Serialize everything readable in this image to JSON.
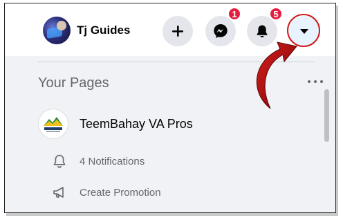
{
  "header": {
    "profile_name": "Tj Guides",
    "messenger_badge": "1",
    "notifications_badge": "5"
  },
  "icons": {
    "create": "plus-icon",
    "messenger": "messenger-icon",
    "notifications": "bell-icon",
    "account": "caret-down-icon",
    "pointer": "curved-arrow-icon"
  },
  "menu": {
    "section_title": "Your Pages",
    "page": {
      "name": "TeemBahay VA Pros",
      "logo_text": "TEEMBAHAY"
    },
    "sub_items": [
      {
        "label": "4 Notifications",
        "icon": "bell-outline-icon"
      },
      {
        "label": "Create Promotion",
        "icon": "megaphone-icon"
      }
    ]
  },
  "colors": {
    "badge": "#e41e3f",
    "annotation": "#d01919",
    "button_bg": "#e4e6eb",
    "panel_bg": "#f0f2f5"
  }
}
